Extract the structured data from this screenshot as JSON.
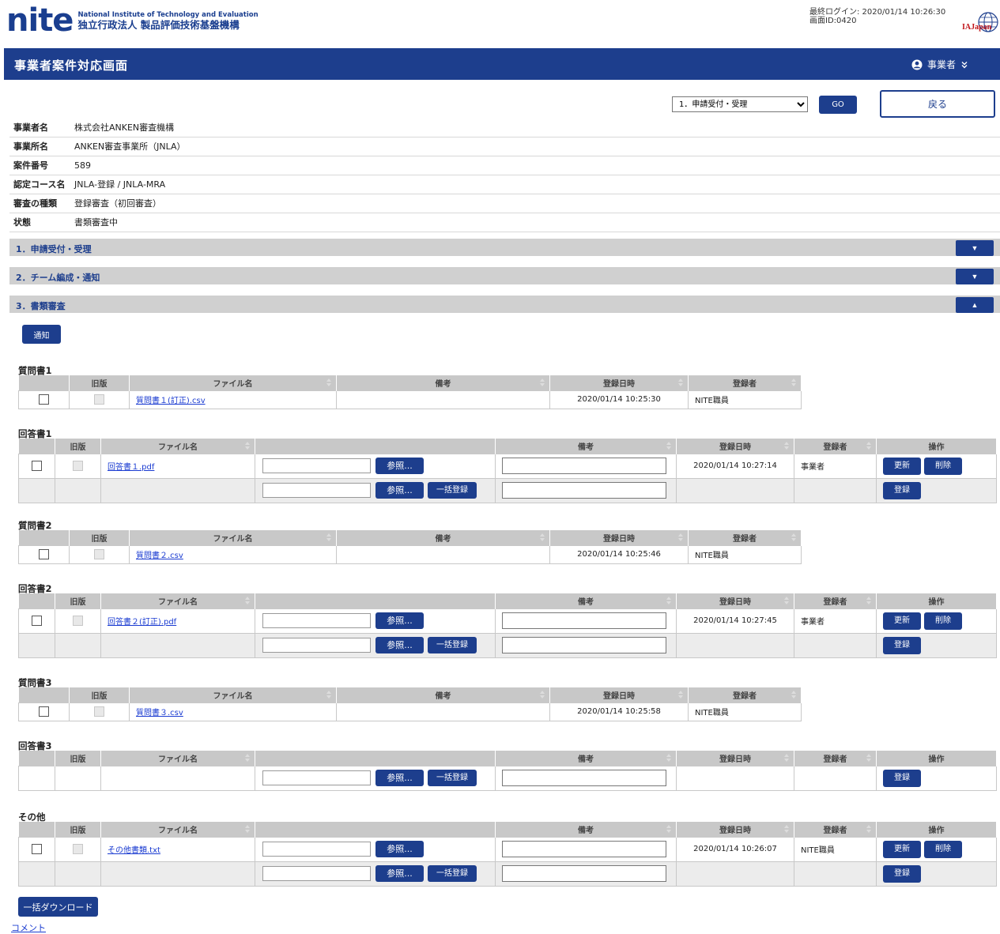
{
  "header": {
    "logo_mark": "nite",
    "logo_en": "National Institute of Technology and Evaluation",
    "logo_ja": "独立行政法人 製品評価技術基盤機構",
    "last_login_label": "最終ログイン: 2020/01/14 10:26:30",
    "screen_id": "画面ID:0420",
    "partner_logo": "IAJapan",
    "title": "事業者案件対応画面",
    "user_label": "事業者"
  },
  "controls": {
    "phase_options": [
      "1．申請受付・受理"
    ],
    "phase_selected": "1．申請受付・受理",
    "go_label": "GO",
    "back_label": "戻る"
  },
  "info": [
    {
      "key": "事業者名",
      "value": "株式会社ANKEN審査機構"
    },
    {
      "key": "事業所名",
      "value": "ANKEN審査事業所（JNLA）"
    },
    {
      "key": "案件番号",
      "value": "589"
    },
    {
      "key": "認定コース名",
      "value": "JNLA-登録 / JNLA-MRA"
    },
    {
      "key": "審査の種類",
      "value": "登録審査（初回審査）"
    },
    {
      "key": "状態",
      "value": "書類審査中"
    }
  ],
  "sections": [
    {
      "label": "1．申請受付・受理",
      "toggle": "▼"
    },
    {
      "label": "2．チーム編成・通知",
      "toggle": "▼"
    },
    {
      "label": "3．書類審査",
      "toggle": "▲"
    }
  ],
  "notify_label": "通知",
  "columns": {
    "old": "旧版",
    "filename": "ファイル名",
    "note": "備考",
    "date": "登録日時",
    "user": "登録者",
    "ops": "操作"
  },
  "buttons": {
    "browse": "参照...",
    "bulk_register": "一括登録",
    "update": "更新",
    "delete": "削除",
    "register": "登録"
  },
  "groups": {
    "q1": {
      "title": "質問書1",
      "file": "質問書１(訂正).csv",
      "date": "2020/01/14 10:25:30",
      "user": "NITE職員"
    },
    "a1": {
      "title": "回答書1",
      "file": "回答書１.pdf",
      "date": "2020/01/14 10:27:14",
      "user": "事業者"
    },
    "q2": {
      "title": "質問書2",
      "file": "質問書２.csv",
      "date": "2020/01/14 10:25:46",
      "user": "NITE職員"
    },
    "a2": {
      "title": "回答書2",
      "file": "回答書２(訂正).pdf",
      "date": "2020/01/14 10:27:45",
      "user": "事業者"
    },
    "q3": {
      "title": "質問書3",
      "file": "質問書３.csv",
      "date": "2020/01/14 10:25:58",
      "user": "NITE職員"
    },
    "a3": {
      "title": "回答書3"
    },
    "other": {
      "title": "その他",
      "file": "その他書類.txt",
      "date": "2020/01/14 10:26:07",
      "user": "NITE職員"
    }
  },
  "footer": {
    "bulk_download": "一括ダウンロード",
    "comment_link": "コメント"
  }
}
